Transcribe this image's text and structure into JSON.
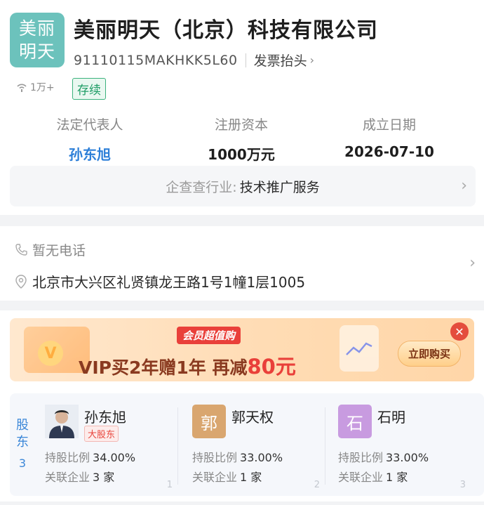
{
  "company": {
    "logo_line1": "美丽",
    "logo_line2": "明天",
    "name": "美丽明天（北京）科技有限公司",
    "credit_code": "91110115MAKHKK5L60",
    "invoice_label": "发票抬头",
    "views": "1万+",
    "status": "存续"
  },
  "key_info": {
    "legal_rep_label": "法定代表人",
    "legal_rep_value": "孙东旭",
    "capital_label": "注册资本",
    "capital_value": "1000万元",
    "founded_label": "成立日期",
    "founded_value": "2026-07-10"
  },
  "industry": {
    "label": "企查查行业:",
    "value": "技术推广服务"
  },
  "contact": {
    "phone": "暂无电话",
    "address": "北京市大兴区礼贤镇龙王路1号1幢1层1005"
  },
  "banner": {
    "tag": "会员超值购",
    "promo_part1": "VIP买2年赠1年  再减",
    "promo_highlight": "80元",
    "buy_button": "立即购买",
    "close_symbol": "✕"
  },
  "shareholders": {
    "tab_label": "股东",
    "count": "3",
    "items": [
      {
        "avatar_text": "",
        "avatar_color": "#3a4a66",
        "name": "孙东旭",
        "badge": "大股东",
        "ratio_label": "持股比例",
        "ratio": "34.00%",
        "rel_label": "关联企业",
        "rel_value": "3 家",
        "index": "1"
      },
      {
        "avatar_text": "郭",
        "avatar_color": "#d9a66f",
        "name": "郭天权",
        "badge": "",
        "ratio_label": "持股比例",
        "ratio": "33.00%",
        "rel_label": "关联企业",
        "rel_value": "1 家",
        "index": "2"
      },
      {
        "avatar_text": "石",
        "avatar_color": "#c89be0",
        "name": "石明",
        "badge": "",
        "ratio_label": "持股比例",
        "ratio": "33.00%",
        "rel_label": "关联企业",
        "rel_value": "1 家",
        "index": "3"
      }
    ]
  },
  "colors": {
    "brand_teal": "#6cc2bc",
    "link_blue": "#2d7fd8",
    "status_green": "#1f9d66",
    "accent_red": "#e9403a"
  }
}
